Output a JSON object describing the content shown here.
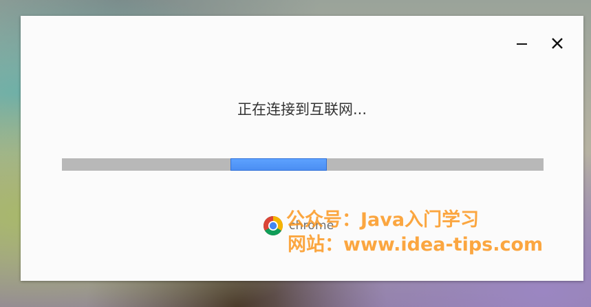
{
  "dialog": {
    "status_text": "正在连接到互联网...",
    "progress_fraction": 0.2,
    "progress_offset_fraction": 0.35,
    "brand_name": "chrome",
    "controls": {
      "minimize_icon": "minimize-icon",
      "close_icon": "close-icon"
    },
    "colors": {
      "progress": "#4a8df2",
      "track": "#b8b8b8"
    }
  },
  "watermark": {
    "line1": "公众号：Java入门学习",
    "line2": "网站：www.idea-tips.com"
  }
}
